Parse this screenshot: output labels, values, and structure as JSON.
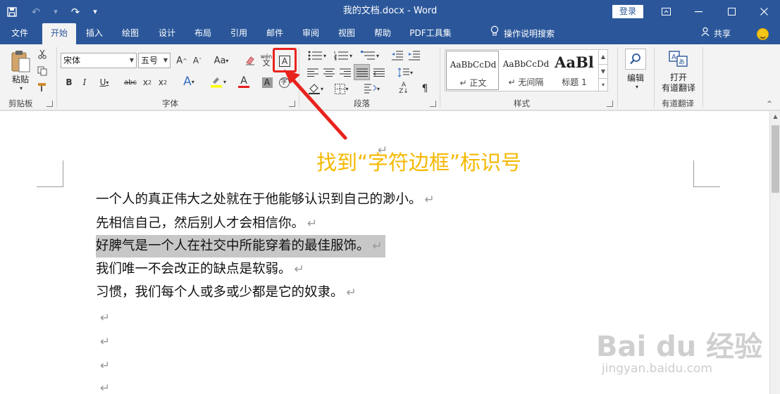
{
  "window": {
    "title": "我的文档.docx - Word",
    "login_label": "登录"
  },
  "tabs": [
    {
      "label": "文件"
    },
    {
      "label": "开始"
    },
    {
      "label": "插入"
    },
    {
      "label": "绘图"
    },
    {
      "label": "设计"
    },
    {
      "label": "布局"
    },
    {
      "label": "引用"
    },
    {
      "label": "邮件"
    },
    {
      "label": "审阅"
    },
    {
      "label": "视图"
    },
    {
      "label": "帮助"
    },
    {
      "label": "PDF工具集"
    }
  ],
  "tell_me": "操作说明搜索",
  "share": "共享",
  "ribbon": {
    "clipboard": {
      "paste_label": "粘贴",
      "group_label": "剪贴板"
    },
    "font": {
      "font_name": "宋体",
      "font_size": "五号",
      "group_label": "字体",
      "char_border_glyph": "A",
      "phonetic_glyph": "wén"
    },
    "paragraph": {
      "group_label": "段落"
    },
    "styles": {
      "group_label": "样式",
      "items": [
        {
          "sample": "AaBbCcDd",
          "name": "正文"
        },
        {
          "sample": "AaBbCcDd",
          "name": "无间隔"
        },
        {
          "sample": "AaBl",
          "name": "标题 1"
        }
      ]
    },
    "editing": {
      "label": "编辑"
    },
    "translate": {
      "label_line1": "打开",
      "label_line2": "有道翻译",
      "group_label": "有道翻译"
    }
  },
  "document": {
    "lines": [
      "一个人的真正伟大之处就在于他能够认识到自己的渺小。",
      "先相信自己，然后别人才会相信你。",
      "好脾气是一个人在社交中所能穿着的最佳服饰。",
      "我们唯一不会改正的缺点是软弱。",
      "习惯，我们每个人或多或少都是它的奴隶。"
    ],
    "paragraph_mark": "↵"
  },
  "annotation": {
    "text": "找到“字符边框”标识号",
    "color": "#f5b800"
  },
  "watermark": {
    "main": "Bai du 经验",
    "sub": "jingyan.baidu.com"
  },
  "colors": {
    "brand": "#2b579a",
    "highlight_red": "#e8231d"
  }
}
